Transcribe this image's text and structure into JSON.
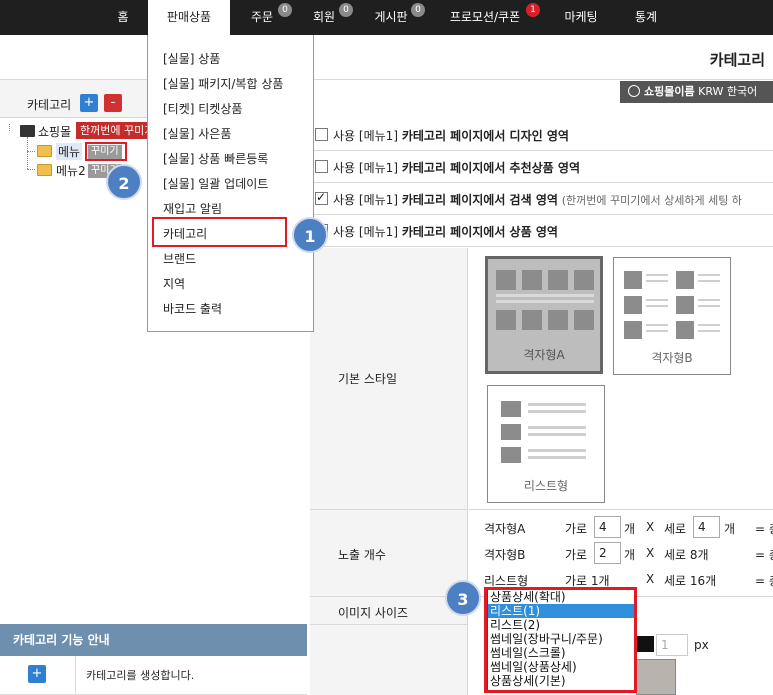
{
  "nav": {
    "items": [
      {
        "label": "홈",
        "badge": ""
      },
      {
        "label": "판매상품",
        "badge": ""
      },
      {
        "label": "주문",
        "badge": "0"
      },
      {
        "label": "회원",
        "badge": "0"
      },
      {
        "label": "게시판",
        "badge": "0"
      },
      {
        "label": "프로모션/쿠폰",
        "badge": "1"
      },
      {
        "label": "마케팅",
        "badge": ""
      },
      {
        "label": "통계",
        "badge": ""
      }
    ]
  },
  "header": {
    "title": "카테고리",
    "shop_name": "쇼핑몰이름",
    "currency": "KRW 한국어"
  },
  "left": {
    "category_label": "카테고리",
    "add_symbol": "+",
    "remove_symbol": "-",
    "tree": {
      "root": "쇼핑몰",
      "root_tag": "한꺼번에 꾸미기",
      "child1": "메뉴",
      "child1_tag": "꾸미기",
      "child2": "메뉴2",
      "child2_tag": "꾸미기"
    },
    "guide_title": "카테고리 기능 안내",
    "guide_row": {
      "icon": "+",
      "text": "카테고리를 생성합니다."
    }
  },
  "dropdown": {
    "items": [
      "[실물] 상품",
      "[실물] 패키지/복합 상품",
      "[티켓] 티켓상품",
      "[실물] 사은품",
      "[실물] 상품 빠른등록",
      "[실물] 일괄 업데이트",
      "재입고 알림",
      "카테고리",
      "브랜드",
      "지역",
      "바코드 출력"
    ]
  },
  "steps": {
    "one": "1",
    "two": "2",
    "three": "3"
  },
  "options": [
    {
      "use": "사용",
      "menu": "[메뉴1]",
      "desc": "카테고리 페이지에서 디자인 영역",
      "note": "",
      "checked": false
    },
    {
      "use": "사용",
      "menu": "[메뉴1]",
      "desc": "카테고리 페이지에서 추천상품 영역",
      "note": "",
      "checked": false
    },
    {
      "use": "사용",
      "menu": "[메뉴1]",
      "desc": "카테고리 페이지에서 검색 영역",
      "note": "(한꺼번에 꾸미기에서 상세하게 세팅 하",
      "checked": true
    },
    {
      "use": "사용",
      "menu": "[메뉴1]",
      "desc": "카테고리 페이지에서 상품 영역",
      "note": "",
      "checked": false
    }
  ],
  "style": {
    "label": "기본 스타일",
    "cards": [
      "격자형A",
      "격자형B",
      "리스트형"
    ]
  },
  "exposure": {
    "label": "노출 개수",
    "rows": [
      {
        "name": "격자형A",
        "cols_label": "가로",
        "cols": "4",
        "unit": "개",
        "x": "X",
        "rows_label": "세로",
        "rows": "4",
        "eq": "= 총"
      },
      {
        "name": "격자형B",
        "cols_label": "가로",
        "cols": "2",
        "unit": "개",
        "x": "X",
        "rows_text": "세로 8개",
        "eq": "= 총"
      },
      {
        "name": "리스트형",
        "cols_text": "가로 1개",
        "x": "X",
        "rows_text": "세로 16개",
        "eq": "= 총"
      }
    ]
  },
  "image_size": {
    "label": "이미지 사이즈",
    "options": [
      "상품상세(확대)",
      "리스트(1)",
      "리스트(2)",
      "썸네일(장바구니/주문)",
      "썸네일(스크롤)",
      "썸네일(상품상세)",
      "상품상세(기본)"
    ],
    "selected_index": 1,
    "px_value": "1",
    "px_unit": "px"
  }
}
